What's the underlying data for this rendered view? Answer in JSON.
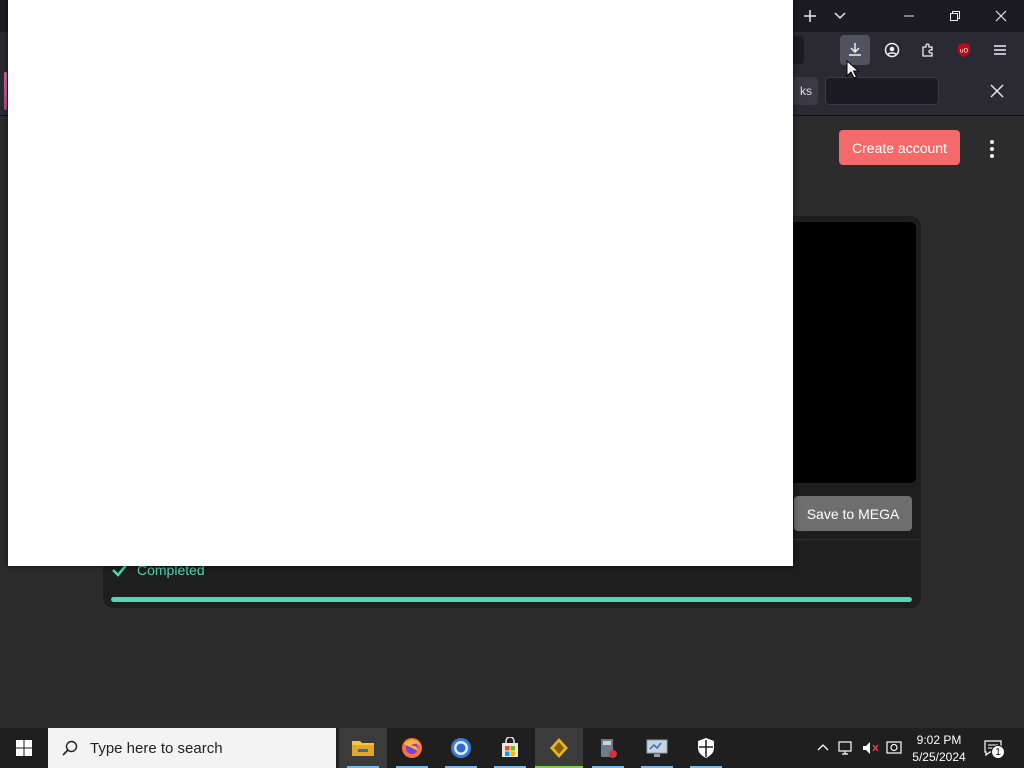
{
  "browser": {
    "findbar_partial_text": "ks",
    "accent_color": "#52525e"
  },
  "page": {
    "create_account_label": "Create account",
    "save_label": "Save to MEGA",
    "status_text": "Completed",
    "progress_fraction": 1.0,
    "accent_green": "#4fd9b3",
    "create_button_color": "#f46a6a"
  },
  "taskbar": {
    "search_placeholder": "Type here to search",
    "time": "9:02 PM",
    "date": "5/25/2024",
    "notification_count": "1",
    "apps": [
      "file-explorer",
      "firefox",
      "chrome",
      "microsoft-store",
      "app-yellow",
      "app-installer",
      "app-monitor",
      "windows-security"
    ]
  }
}
